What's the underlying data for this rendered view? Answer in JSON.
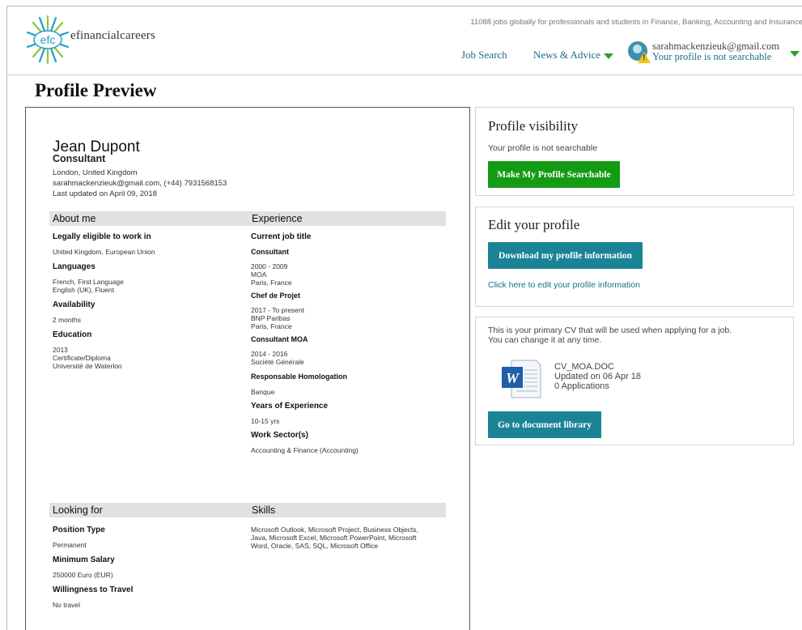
{
  "header": {
    "brand": "efinancialcareers",
    "logo_text": "efc",
    "tagline": "11088 jobs globally for professionals and students in Finance, Banking, Accounting and Insurance",
    "nav": {
      "job_search": "Job Search",
      "news_advice": "News & Advice"
    },
    "user": {
      "email": "sarahmackenzieuk@gmail.com",
      "status": "Your profile is not searchable"
    }
  },
  "page_title": "Profile Preview",
  "profile": {
    "name": "Jean Dupont",
    "title": "Consultant",
    "location": "London, United Kingdom",
    "contact": "sarahmackenzieuk@gmail.com, (+44) 7931568153",
    "updated": "Last updated on April 09, 2018"
  },
  "about": {
    "heading": "About me",
    "legal_label": "Legally eligible to work in",
    "legal_value": "United Kingdom, European Union",
    "languages_label": "Languages",
    "languages_lines": [
      "French, First Language",
      "English (UK), Fluent"
    ],
    "availability_label": "Availability",
    "availability_value": "2 months",
    "education_label": "Education",
    "education_lines": [
      "2013",
      "Certificate/Diploma",
      "Université de Waterloo"
    ]
  },
  "experience": {
    "heading": "Experience",
    "current_label": "Current job title",
    "jobs": [
      {
        "title": "Consultant",
        "lines": [
          "2000 - 2009",
          "MOA",
          "Paris, France"
        ]
      },
      {
        "title": "Chef de Projet",
        "lines": [
          "2017 - To present",
          "BNP Paribas",
          "Paris, France"
        ]
      },
      {
        "title": "Consultant MOA",
        "lines": [
          "2014 - 2016",
          "Société Générale"
        ]
      },
      {
        "title": "Responsable Homologation",
        "lines": [
          "Banque"
        ]
      }
    ],
    "years_label": "Years of Experience",
    "years_value": "10-15 yrs",
    "sector_label": "Work Sector(s)",
    "sector_value": "Accounting & Finance (Accounting)"
  },
  "looking": {
    "heading": "Looking for",
    "position_label": "Position Type",
    "position_value": "Permanent",
    "salary_label": "Minimum Salary",
    "salary_value": "250000 Euro (EUR)",
    "travel_label": "Willingness to Travel",
    "travel_value": "No travel"
  },
  "skills": {
    "heading": "Skills",
    "lines": [
      "Microsoft Outlook, Microsoft Project, Business Objects,",
      "Java, Microsoft Excel, Microsoft PowerPoint, Microsoft",
      "Word, Oracle, SAS, SQL, Microsoft Office"
    ]
  },
  "visibility_panel": {
    "heading": "Profile visibility",
    "text": "Your profile is not searchable",
    "button": "Make My Profile Searchable"
  },
  "edit_panel": {
    "heading": "Edit your profile",
    "button": "Download my profile information",
    "link": "Click here to edit your profile information"
  },
  "cv_panel": {
    "lines": [
      "This is your primary CV that will be used when applying for a job.",
      "You can change it at any time."
    ],
    "file_name": "CV_MOA.DOC",
    "file_updated": "Updated on 06 Apr 18",
    "file_apps": "0 Applications",
    "button": "Go to document library"
  },
  "colors": {
    "green": "#139b13",
    "teal": "#1a8496",
    "link": "#1b6e8a",
    "section_bar": "#e1e1e1"
  },
  "icons": [
    "efc-logo-icon",
    "chevron-down-icon",
    "user-avatar-icon",
    "warning-icon",
    "word-document-icon"
  ]
}
